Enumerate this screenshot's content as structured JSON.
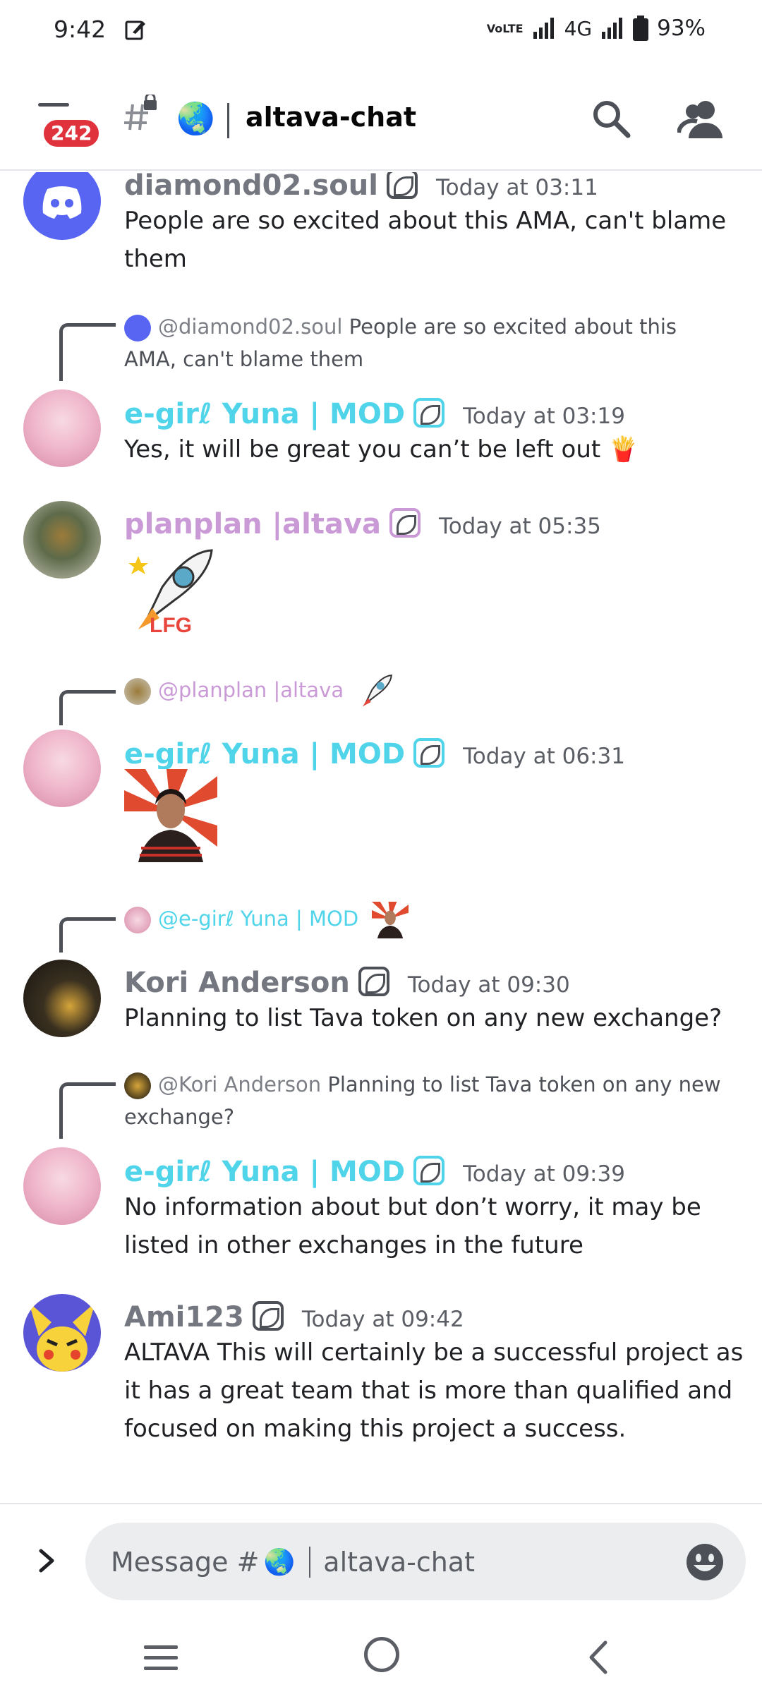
{
  "status_bar": {
    "time": "9:42",
    "network": "4G",
    "volte": "VoLTE",
    "battery": "93%"
  },
  "header": {
    "unread_badge": "242",
    "channel_emoji": "🌏",
    "channel_name": "altava-chat"
  },
  "messages": [
    {
      "author": "diamond02.soul",
      "time": "Today at 03:11",
      "text": "People are so excited about this AMA, can't blame them"
    },
    {
      "reply": {
        "author": "@diamond02.soul",
        "text": "People are so excited about this AMA, can't blame them"
      },
      "author": "e-girℓ Yuna | MOD",
      "time": "Today at 03:19",
      "text": "Yes, it will be great you can’t be left out",
      "trailing_emoji": "🍟"
    },
    {
      "author": "planplan |altava",
      "time": "Today at 05:35",
      "sticker": "LFG rocket sticker"
    },
    {
      "reply": {
        "author": "@planplan |altava"
      },
      "author": "e-girℓ Yuna | MOD",
      "time": "Today at 06:31",
      "sticker": "portrait sticker"
    },
    {
      "reply": {
        "author": "@e-girℓ Yuna | MOD"
      },
      "author": "Kori Anderson",
      "time": "Today at 09:30",
      "text": "Planning to list Tava token on any new exchange?"
    },
    {
      "reply": {
        "author": "@Kori Anderson",
        "text": "Planning to list Tava token on any new exchange?"
      },
      "author": "e-girℓ Yuna | MOD",
      "time": "Today at 09:39",
      "text": "No information about but don’t worry, it may be listed in other exchanges  in the future"
    },
    {
      "author": "Ami123",
      "time": "Today at 09:42",
      "text": "ALTAVA This will certainly be a successful project as it has a great team that is more than qualified and focused on making this project a success."
    }
  ],
  "composer": {
    "placeholder_prefix": "Message #",
    "placeholder_emoji": "🌏",
    "placeholder_channel": "altava-chat"
  },
  "colors": {
    "mod": "#4fd4ea",
    "planplan": "#c99ad6",
    "default_user": "#747780",
    "badge": "#e0323c"
  },
  "icons": [
    "edit-icon",
    "signal-icon",
    "battery-icon",
    "menu-icon",
    "hash-lock-icon",
    "search-icon",
    "members-icon",
    "chevron-right-icon",
    "emoji-icon",
    "nav-menu-icon",
    "nav-home-icon",
    "nav-back-icon"
  ]
}
